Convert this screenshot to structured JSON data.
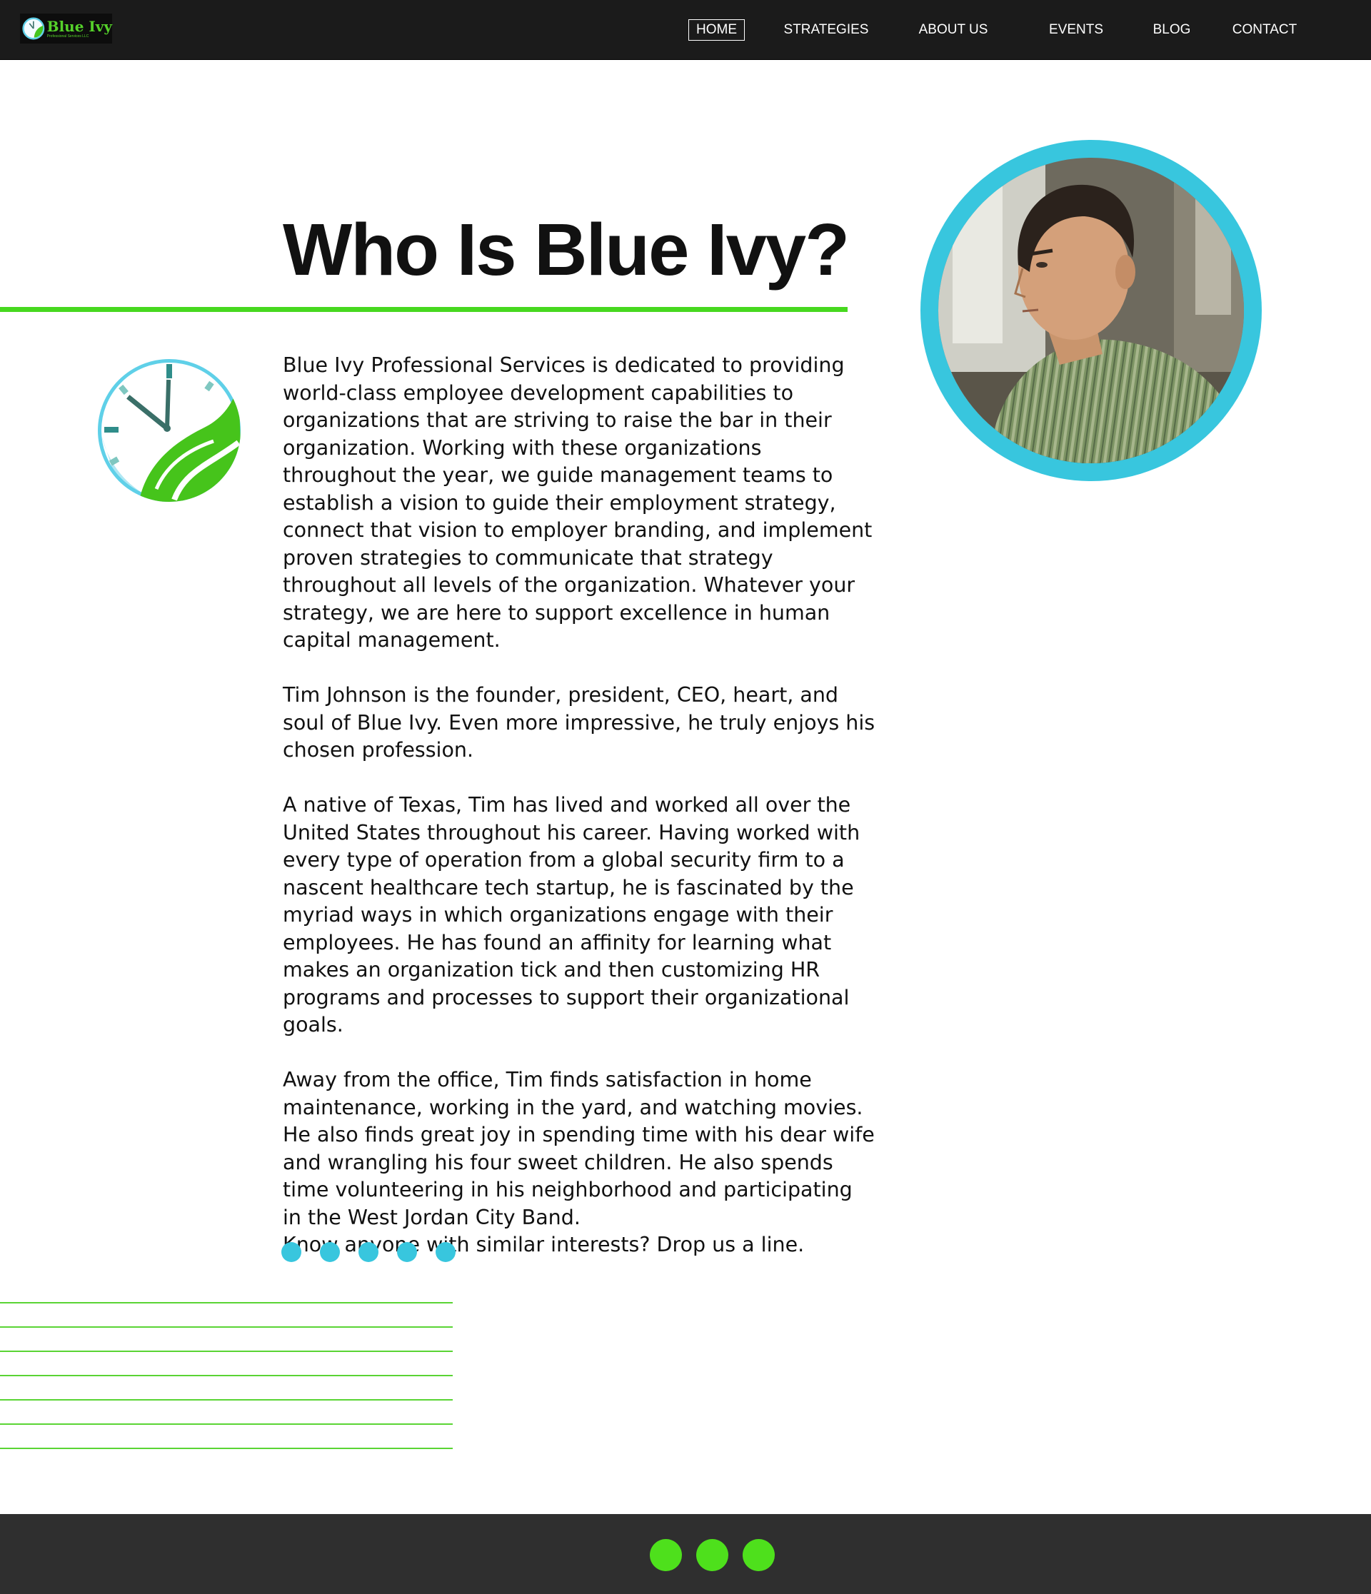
{
  "brand": {
    "name": "Blue Ivy",
    "tagline": "Professional Services LLC"
  },
  "nav": {
    "home": "HOME",
    "strategies": "STRATEGIES",
    "about": "ABOUT US",
    "events": "EVENTS",
    "blog": "BLOG",
    "contact": "CONTACT",
    "active": "HOME"
  },
  "hero": {
    "title": "Who Is Blue Ivy?"
  },
  "content": {
    "paragraphs": [
      "Blue Ivy Professional Services is dedicated to providing world-class employee development capabilities to organizations that are striving to raise the bar in their organization. Working with these organizations throughout the year, we guide management teams to establish a vision to guide their employment strategy, connect that vision to employer branding, and implement proven strategies to communicate that strategy throughout all levels of the organization.  Whatever your strategy, we are here to support excellence in human capital management.",
      "Tim Johnson is the founder, president, CEO, heart, and soul of Blue Ivy.  Even more impressive, he truly enjoys his chosen profession.",
      "A native of Texas, Tim has lived and worked all over the United States throughout his career.  Having worked with every type of operation from a global security firm to a nascent healthcare tech startup, he is fascinated by the myriad ways in which organizations engage with their employees. He has found an affinity for learning what makes an organization tick and then customizing HR programs and processes to support their organizational goals.",
      "Away from the office, Tim finds satisfaction in home maintenance, working in the yard, and watching movies.  He also finds great joy in spending time with his dear wife and wrangling his four sweet children.  He also spends time volunteering in his neighborhood and participating in the West Jordan City Band.",
      "Know anyone with similar interests?  Drop us a line."
    ]
  },
  "icons": {
    "brand_logo": "clock-leaf-icon",
    "side_logo": "clock-leaf-icon",
    "portrait": "portrait-photo"
  },
  "carousel": {
    "dot_count": 5
  },
  "footer": {
    "dot_count": 3
  },
  "colors": {
    "nav_background": "#1b1b1b",
    "accent_green": "#47d81f",
    "accent_blue": "#38c6de",
    "footer_background": "#2f2f2f",
    "text": "#111111"
  }
}
